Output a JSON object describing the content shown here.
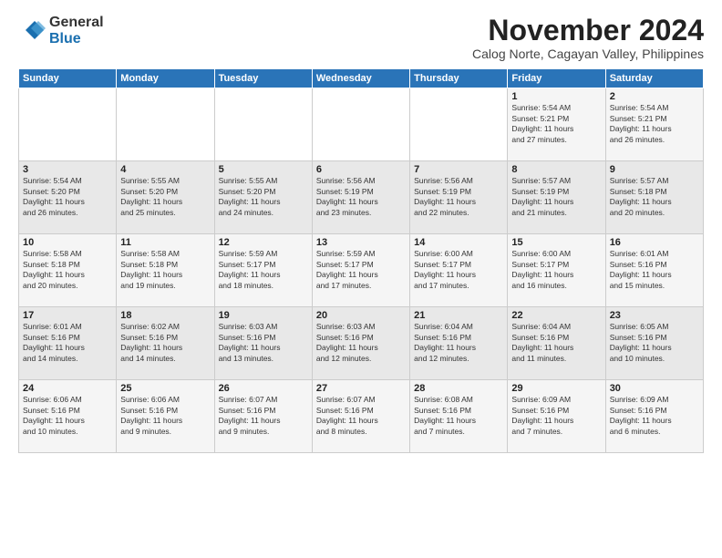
{
  "logo": {
    "general": "General",
    "blue": "Blue"
  },
  "title": "November 2024",
  "subtitle": "Calog Norte, Cagayan Valley, Philippines",
  "days_of_week": [
    "Sunday",
    "Monday",
    "Tuesday",
    "Wednesday",
    "Thursday",
    "Friday",
    "Saturday"
  ],
  "weeks": [
    [
      {
        "day": "",
        "info": ""
      },
      {
        "day": "",
        "info": ""
      },
      {
        "day": "",
        "info": ""
      },
      {
        "day": "",
        "info": ""
      },
      {
        "day": "",
        "info": ""
      },
      {
        "day": "1",
        "info": "Sunrise: 5:54 AM\nSunset: 5:21 PM\nDaylight: 11 hours\nand 27 minutes."
      },
      {
        "day": "2",
        "info": "Sunrise: 5:54 AM\nSunset: 5:21 PM\nDaylight: 11 hours\nand 26 minutes."
      }
    ],
    [
      {
        "day": "3",
        "info": "Sunrise: 5:54 AM\nSunset: 5:20 PM\nDaylight: 11 hours\nand 26 minutes."
      },
      {
        "day": "4",
        "info": "Sunrise: 5:55 AM\nSunset: 5:20 PM\nDaylight: 11 hours\nand 25 minutes."
      },
      {
        "day": "5",
        "info": "Sunrise: 5:55 AM\nSunset: 5:20 PM\nDaylight: 11 hours\nand 24 minutes."
      },
      {
        "day": "6",
        "info": "Sunrise: 5:56 AM\nSunset: 5:19 PM\nDaylight: 11 hours\nand 23 minutes."
      },
      {
        "day": "7",
        "info": "Sunrise: 5:56 AM\nSunset: 5:19 PM\nDaylight: 11 hours\nand 22 minutes."
      },
      {
        "day": "8",
        "info": "Sunrise: 5:57 AM\nSunset: 5:19 PM\nDaylight: 11 hours\nand 21 minutes."
      },
      {
        "day": "9",
        "info": "Sunrise: 5:57 AM\nSunset: 5:18 PM\nDaylight: 11 hours\nand 20 minutes."
      }
    ],
    [
      {
        "day": "10",
        "info": "Sunrise: 5:58 AM\nSunset: 5:18 PM\nDaylight: 11 hours\nand 20 minutes."
      },
      {
        "day": "11",
        "info": "Sunrise: 5:58 AM\nSunset: 5:18 PM\nDaylight: 11 hours\nand 19 minutes."
      },
      {
        "day": "12",
        "info": "Sunrise: 5:59 AM\nSunset: 5:17 PM\nDaylight: 11 hours\nand 18 minutes."
      },
      {
        "day": "13",
        "info": "Sunrise: 5:59 AM\nSunset: 5:17 PM\nDaylight: 11 hours\nand 17 minutes."
      },
      {
        "day": "14",
        "info": "Sunrise: 6:00 AM\nSunset: 5:17 PM\nDaylight: 11 hours\nand 17 minutes."
      },
      {
        "day": "15",
        "info": "Sunrise: 6:00 AM\nSunset: 5:17 PM\nDaylight: 11 hours\nand 16 minutes."
      },
      {
        "day": "16",
        "info": "Sunrise: 6:01 AM\nSunset: 5:16 PM\nDaylight: 11 hours\nand 15 minutes."
      }
    ],
    [
      {
        "day": "17",
        "info": "Sunrise: 6:01 AM\nSunset: 5:16 PM\nDaylight: 11 hours\nand 14 minutes."
      },
      {
        "day": "18",
        "info": "Sunrise: 6:02 AM\nSunset: 5:16 PM\nDaylight: 11 hours\nand 14 minutes."
      },
      {
        "day": "19",
        "info": "Sunrise: 6:03 AM\nSunset: 5:16 PM\nDaylight: 11 hours\nand 13 minutes."
      },
      {
        "day": "20",
        "info": "Sunrise: 6:03 AM\nSunset: 5:16 PM\nDaylight: 11 hours\nand 12 minutes."
      },
      {
        "day": "21",
        "info": "Sunrise: 6:04 AM\nSunset: 5:16 PM\nDaylight: 11 hours\nand 12 minutes."
      },
      {
        "day": "22",
        "info": "Sunrise: 6:04 AM\nSunset: 5:16 PM\nDaylight: 11 hours\nand 11 minutes."
      },
      {
        "day": "23",
        "info": "Sunrise: 6:05 AM\nSunset: 5:16 PM\nDaylight: 11 hours\nand 10 minutes."
      }
    ],
    [
      {
        "day": "24",
        "info": "Sunrise: 6:06 AM\nSunset: 5:16 PM\nDaylight: 11 hours\nand 10 minutes."
      },
      {
        "day": "25",
        "info": "Sunrise: 6:06 AM\nSunset: 5:16 PM\nDaylight: 11 hours\nand 9 minutes."
      },
      {
        "day": "26",
        "info": "Sunrise: 6:07 AM\nSunset: 5:16 PM\nDaylight: 11 hours\nand 9 minutes."
      },
      {
        "day": "27",
        "info": "Sunrise: 6:07 AM\nSunset: 5:16 PM\nDaylight: 11 hours\nand 8 minutes."
      },
      {
        "day": "28",
        "info": "Sunrise: 6:08 AM\nSunset: 5:16 PM\nDaylight: 11 hours\nand 7 minutes."
      },
      {
        "day": "29",
        "info": "Sunrise: 6:09 AM\nSunset: 5:16 PM\nDaylight: 11 hours\nand 7 minutes."
      },
      {
        "day": "30",
        "info": "Sunrise: 6:09 AM\nSunset: 5:16 PM\nDaylight: 11 hours\nand 6 minutes."
      }
    ]
  ]
}
